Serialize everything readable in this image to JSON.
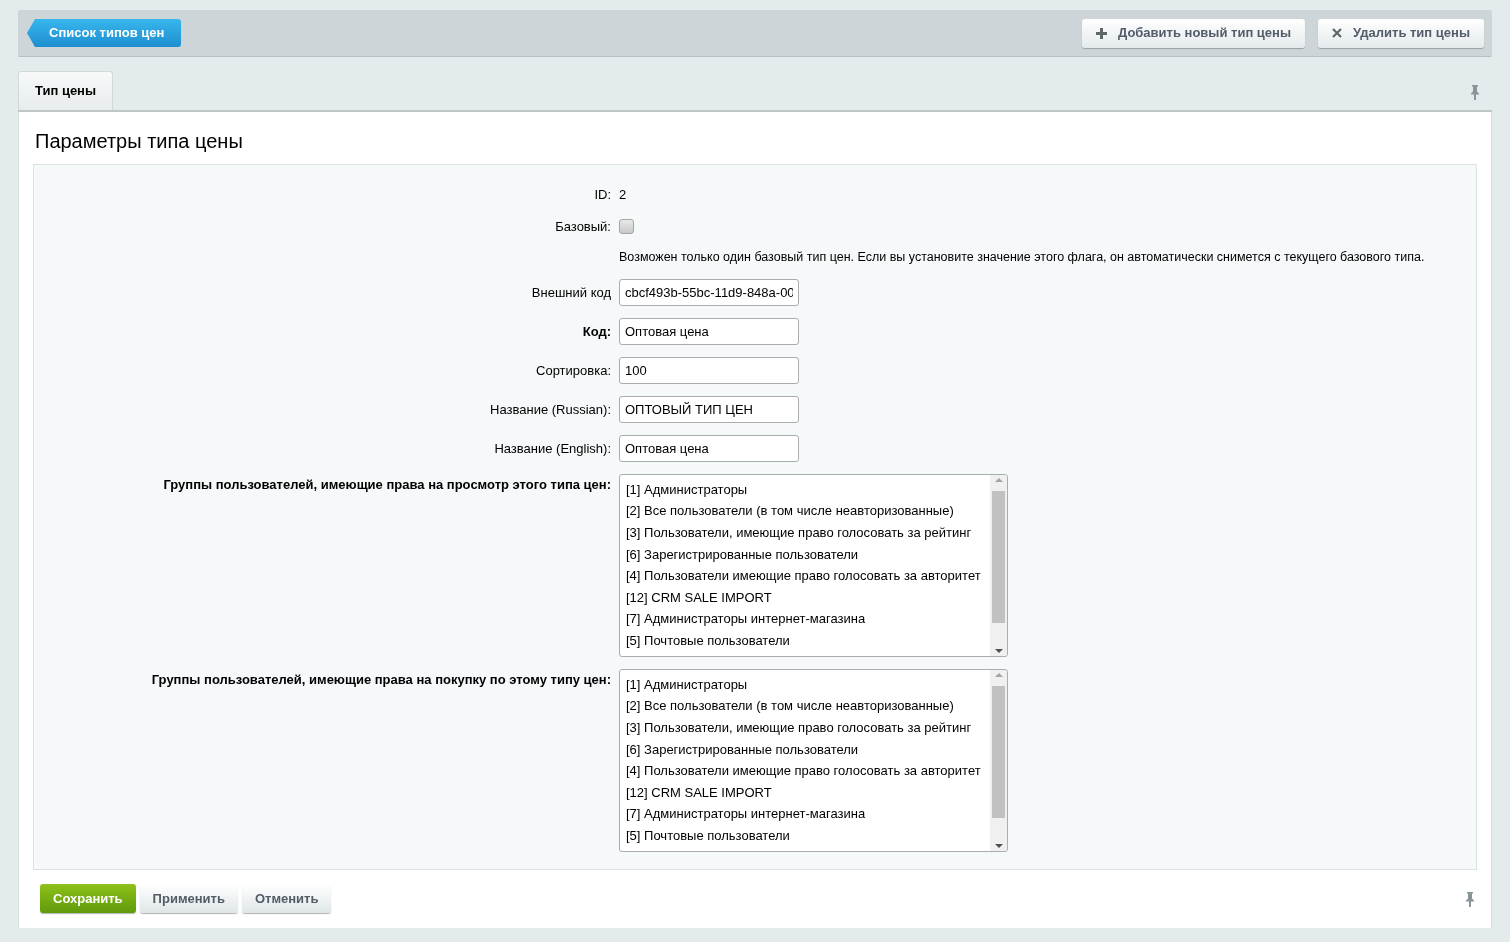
{
  "toolbar": {
    "back_button": "Список типов цен",
    "actions": [
      {
        "kind": "add",
        "label": "Добавить новый тип цены"
      },
      {
        "kind": "delete",
        "label": "Удалить тип цены"
      }
    ]
  },
  "tabs": [
    {
      "label": "Тип цены",
      "selected": true
    }
  ],
  "panel": {
    "title": "Параметры типа цены",
    "fields": [
      {
        "kind": "static",
        "label": "ID:",
        "required": false,
        "value": "2"
      },
      {
        "kind": "checkbox",
        "label": "Базовый:",
        "required": false,
        "checked": false
      },
      {
        "kind": "note",
        "text": "Возможен только один базовый тип цен. Если вы установите значение этого флага, он автоматически снимется с текущего базового типа."
      },
      {
        "kind": "input",
        "label": "Внешний код",
        "required": false,
        "value": "cbcf493b-55bc-11d9-848a-00"
      },
      {
        "kind": "input",
        "label": "Код:",
        "required": true,
        "value": "Оптовая цена"
      },
      {
        "kind": "input",
        "label": "Сортировка:",
        "required": false,
        "value": "100"
      },
      {
        "kind": "input",
        "label": "Название (Russian):",
        "required": false,
        "value": "ОПТОВЫЙ ТИП ЦЕН"
      },
      {
        "kind": "input",
        "label": "Название (English):",
        "required": false,
        "value": "Оптовая цена"
      },
      {
        "kind": "listbox",
        "label": "Группы пользователей, имеющие права на просмотр этого типа цен:",
        "required": true,
        "options": [
          {
            "label": "[1] Администраторы",
            "selected": false
          },
          {
            "label": "[2] Все пользователи (в том числе неавторизованные)",
            "selected": false
          },
          {
            "label": "[3] Пользователи, имеющие право голосовать за рейтинг",
            "selected": false
          },
          {
            "label": "[6] Зарегистрированные пользователи",
            "selected": false
          },
          {
            "label": "[4] Пользователи имеющие право голосовать за авторитет",
            "selected": false
          },
          {
            "label": "[12] CRM SALE IMPORT",
            "selected": false
          },
          {
            "label": "[7] Администраторы интернет-магазина",
            "selected": false
          },
          {
            "label": "[5] Почтовые пользователи",
            "selected": false
          }
        ]
      },
      {
        "kind": "listbox",
        "label": "Группы пользователей, имеющие права на покупку по этому типу цен:",
        "required": true,
        "options": [
          {
            "label": "[1] Администраторы",
            "selected": false
          },
          {
            "label": "[2] Все пользователи (в том числе неавторизованные)",
            "selected": false
          },
          {
            "label": "[3] Пользователи, имеющие право голосовать за рейтинг",
            "selected": false
          },
          {
            "label": "[6] Зарегистрированные пользователи",
            "selected": false
          },
          {
            "label": "[4] Пользователи имеющие право голосовать за авторитет",
            "selected": false
          },
          {
            "label": "[12] CRM SALE IMPORT",
            "selected": false
          },
          {
            "label": "[7] Администраторы интернет-магазина",
            "selected": false
          },
          {
            "label": "[5] Почтовые пользователи",
            "selected": false
          }
        ]
      }
    ]
  },
  "footer_buttons": [
    {
      "kind": "primary",
      "label": "Сохранить"
    },
    {
      "kind": "default",
      "label": "Применить"
    },
    {
      "kind": "default",
      "label": "Отменить"
    }
  ]
}
